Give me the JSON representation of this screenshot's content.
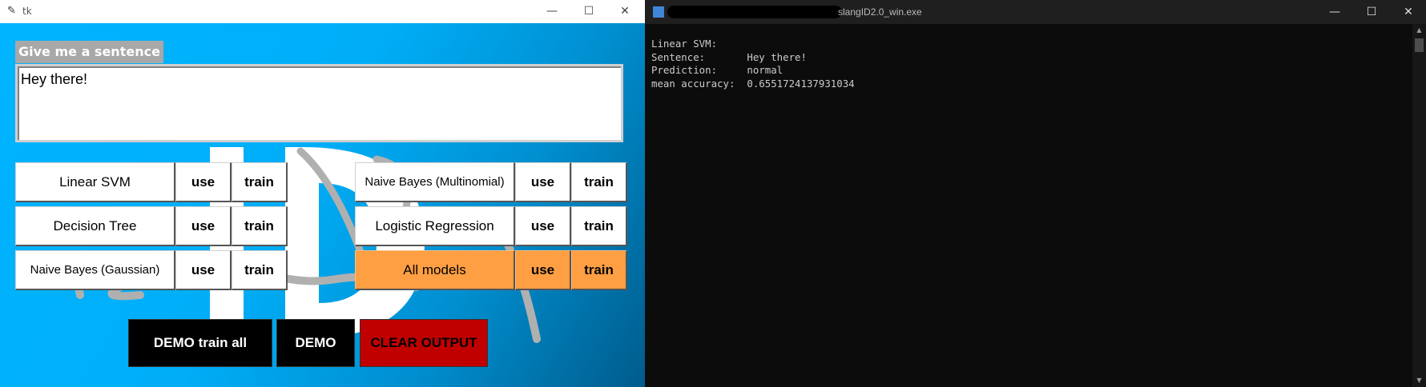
{
  "tk_window": {
    "title": "tk",
    "controls": {
      "minimize": "—",
      "maximize": "☐",
      "close": "✕"
    }
  },
  "form": {
    "prompt": "Give me a sentence",
    "sentence_value": "Hey there!"
  },
  "models_left": [
    {
      "name": "Linear SVM",
      "use": "use",
      "train": "train"
    },
    {
      "name": "Decision Tree",
      "use": "use",
      "train": "train"
    },
    {
      "name": "Naive Bayes (Gaussian)",
      "use": "use",
      "train": "train"
    }
  ],
  "models_right": [
    {
      "name": "Naive Bayes (Multinomial)",
      "use": "use",
      "train": "train"
    },
    {
      "name": "Logistic Regression",
      "use": "use",
      "train": "train"
    },
    {
      "name": "All models",
      "use": "use",
      "train": "train"
    }
  ],
  "actions": {
    "demo_train_all": "DEMO train all",
    "demo": "DEMO",
    "clear_output": "CLEAR OUTPUT"
  },
  "colors": {
    "accent_blue": "#00b4ff",
    "all_models_orange": "#ff9f43",
    "clear_red": "#c00000",
    "console_bg": "#0c0c0c"
  },
  "console": {
    "title": "slangID2.0_win.exe",
    "controls": {
      "minimize": "—",
      "maximize": "☐",
      "close": "✕"
    },
    "output_lines": [
      "Linear SVM:",
      "Sentence:       Hey there!",
      "Prediction:     normal",
      "mean accuracy:  0.6551724137931034"
    ]
  }
}
